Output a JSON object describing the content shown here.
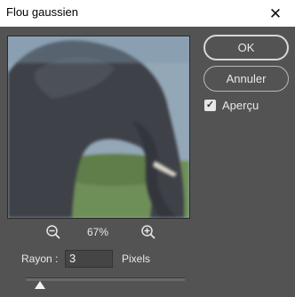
{
  "window": {
    "title": "Flou gaussien",
    "close_glyph": "✕"
  },
  "buttons": {
    "ok": "OK",
    "cancel": "Annuler"
  },
  "preview_option": {
    "label": "Aperçu",
    "checked": true
  },
  "zoom": {
    "percent": "67%"
  },
  "radius": {
    "label": "Rayon :",
    "value": "3",
    "unit": "Pixels",
    "slider_fraction": 0.09
  },
  "icons": {
    "zoom_out": "zoom-out-icon",
    "zoom_in": "zoom-in-icon"
  }
}
